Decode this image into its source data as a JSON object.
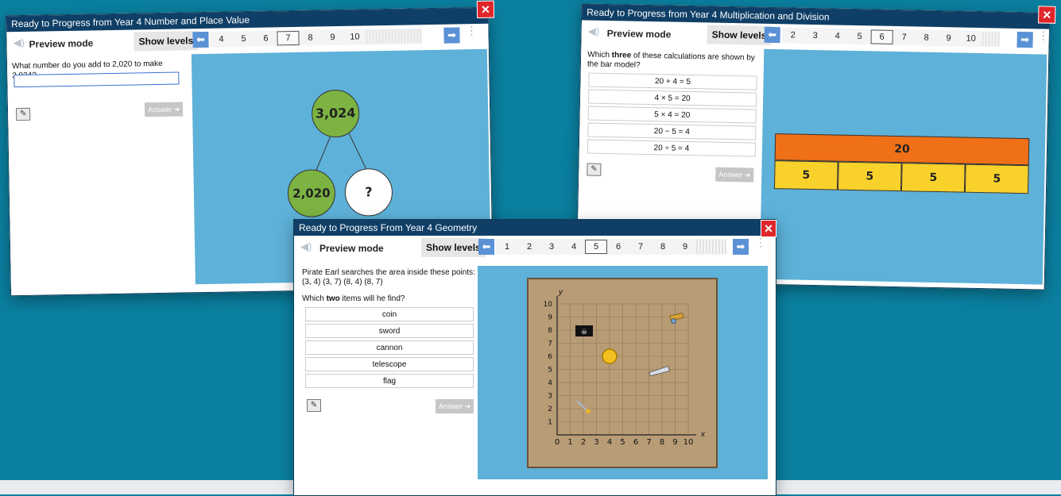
{
  "common": {
    "preview_label": "Preview mode",
    "show_levels": "Show levels",
    "answer_label": "Answer ➜"
  },
  "w1": {
    "title": "Ready to Progress from Year 4 Number and Place Value",
    "levels": [
      "4",
      "5",
      "6",
      "7",
      "8",
      "9",
      "10"
    ],
    "selected": "7",
    "question": "What number do you add to 2,020 to make 3,024?",
    "input_value": "",
    "tree": {
      "top": "3,024",
      "left": "2,020",
      "right": "?"
    }
  },
  "w2": {
    "title": "Ready to Progress from Year 4 Multiplication and Division",
    "levels": [
      "2",
      "3",
      "4",
      "5",
      "6",
      "7",
      "8",
      "9",
      "10"
    ],
    "selected": "6",
    "question_pre": "Which ",
    "question_bold": "three",
    "question_post": " of these calculations are shown by the bar model?",
    "options": [
      "20 + 4 = 5",
      "4 × 5 = 20",
      "5 × 4 = 20",
      "20 − 5 = 4",
      "20 ÷ 5 = 4"
    ],
    "bar_total": "20",
    "bar_parts": [
      "5",
      "5",
      "5",
      "5"
    ]
  },
  "w3": {
    "title": "Ready to Progress From Year 4 Geometry",
    "levels": [
      "1",
      "2",
      "3",
      "4",
      "5",
      "6",
      "7",
      "8",
      "9"
    ],
    "selected": "5",
    "question_line1": "Pirate Earl searches the area inside these points:",
    "question_line2": "(3, 4) (3, 7) (8, 4) (8, 7)",
    "question2_pre": "Which ",
    "question2_bold": "two",
    "question2_post": " items will he find?",
    "options": [
      "coin",
      "sword",
      "cannon",
      "telescope",
      "flag"
    ],
    "grid": {
      "x_label": "x",
      "y_label": "y",
      "x_ticks": [
        "0",
        "1",
        "2",
        "3",
        "4",
        "5",
        "6",
        "7",
        "8",
        "9",
        "10"
      ],
      "y_ticks": [
        "0",
        "1",
        "2",
        "3",
        "4",
        "5",
        "6",
        "7",
        "8",
        "9",
        "10"
      ]
    }
  },
  "colors": {
    "background": "#0b7f9f",
    "titlebar": "#0f3f66",
    "stage": "#5eb1d8",
    "green_circle": "#7cb342",
    "bar_total": "#f07018",
    "bar_part": "#f9d12b",
    "map": "#b89c76"
  },
  "icons": [
    "speaker-icon",
    "left-arrow-icon",
    "right-arrow-icon",
    "more-icon",
    "close-icon",
    "notepad-icon",
    "coin-icon",
    "sword-icon",
    "cannon-icon",
    "telescope-icon",
    "flag-icon"
  ]
}
